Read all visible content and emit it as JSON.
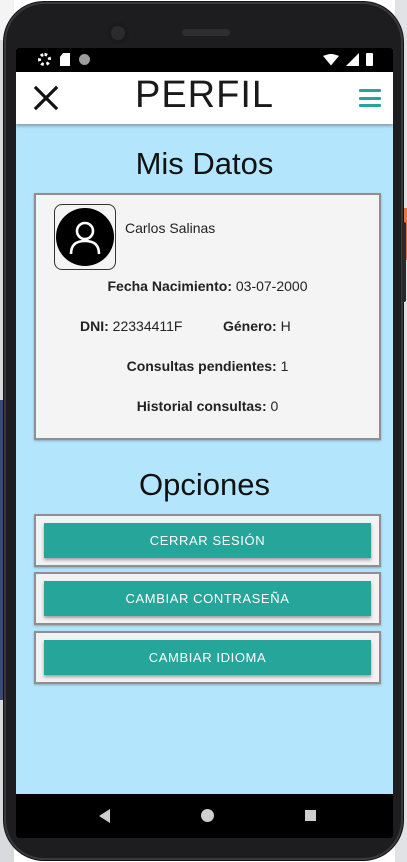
{
  "app_bar": {
    "title": "PERFIL",
    "close_icon": "close-icon",
    "menu_icon": "hamburger-menu-icon",
    "accent_color": "#26a69a"
  },
  "profile": {
    "section_title": "Mis Datos",
    "avatar_icon": "user-avatar-icon",
    "name": "Carlos Salinas",
    "birth_date_label": "Fecha Nacimiento:",
    "birth_date_value": "03-07-2000",
    "dni_label": "DNI:",
    "dni_value": "22334411F",
    "gender_label": "Género:",
    "gender_value": "H",
    "pending_label": "Consultas pendientes:",
    "pending_value": "1",
    "history_label": "Historial consultas:",
    "history_value": "0"
  },
  "options": {
    "section_title": "Opciones",
    "logout_label": "CERRAR SESIÓN",
    "change_password_label": "CAMBIAR CONTRASEÑA",
    "change_language_label": "CAMBIAR IDIOMA"
  },
  "colors": {
    "screen_background": "#b3e5fc",
    "button": "#26a69a"
  }
}
